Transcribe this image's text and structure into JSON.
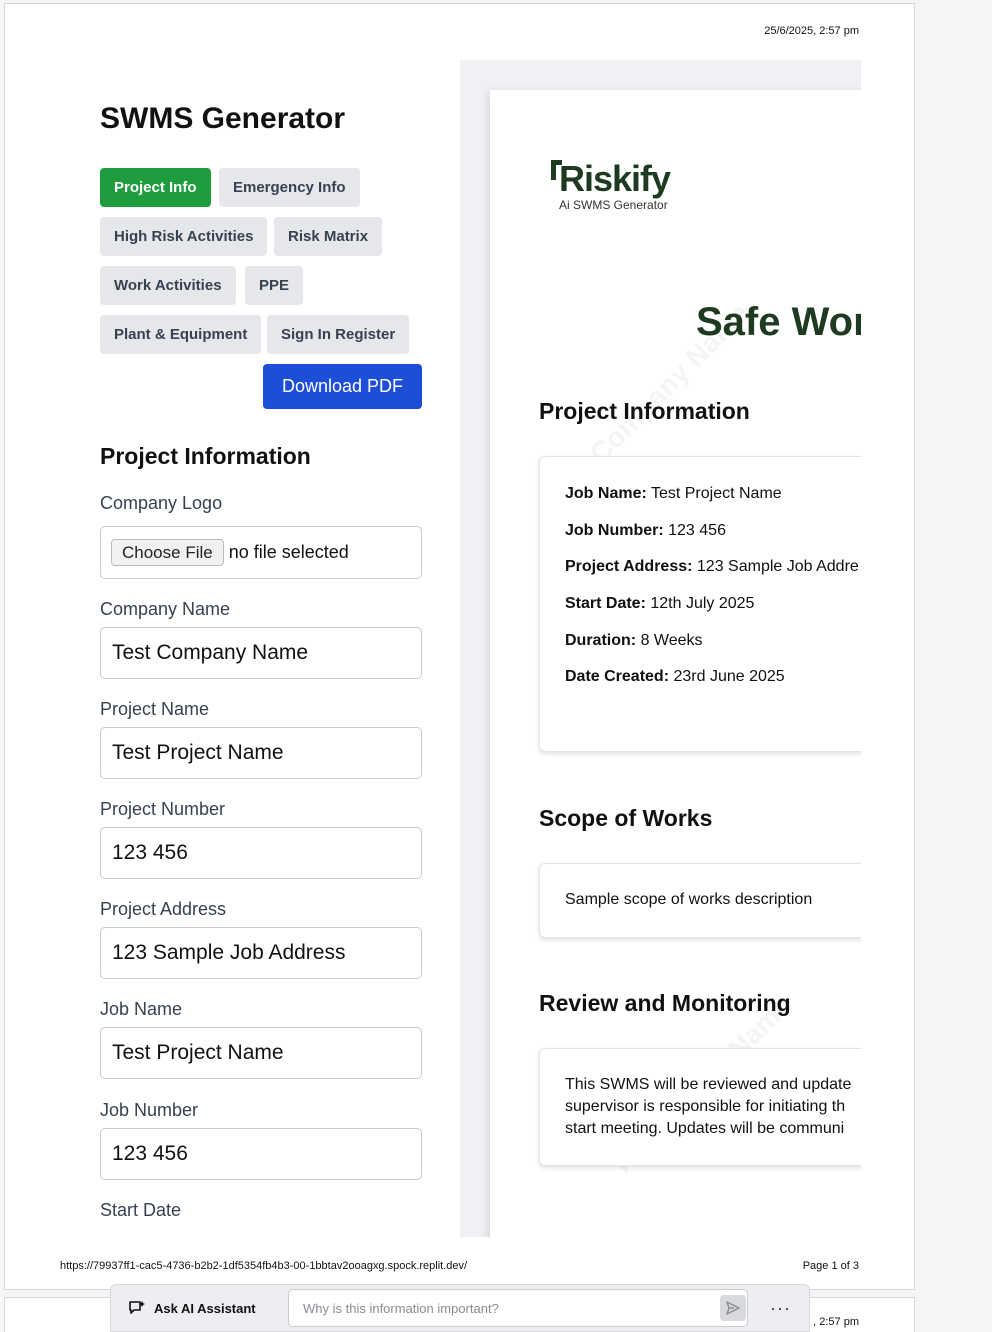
{
  "print": {
    "datetime": "25/6/2025, 2:57 pm",
    "url": "https://79937ff1-cac5-4736-b2b2-1df5354fb4b3-00-1bbtav2ooagxg.spock.replit.dev/",
    "page_label": "Page 1 of 3",
    "next_page_time": ", 2:57 pm"
  },
  "app": {
    "title": "SWMS Generator",
    "tabs": [
      {
        "label": "Project Info",
        "active": true
      },
      {
        "label": "Emergency Info"
      },
      {
        "label": "High Risk Activities"
      },
      {
        "label": "Risk Matrix"
      },
      {
        "label": "Work Activities"
      },
      {
        "label": "PPE"
      },
      {
        "label": "Plant & Equipment"
      },
      {
        "label": "Sign In Register"
      }
    ],
    "download_label": "Download PDF",
    "accent_color": "#1f9d3e",
    "download_color": "#1d4ed8"
  },
  "form": {
    "section_title": "Project Information",
    "logo_label": "Company Logo",
    "file_button": "Choose File",
    "file_status": "no file selected",
    "fields": [
      {
        "label": "Company Name",
        "value": "Test Company Name"
      },
      {
        "label": "Project Name",
        "value": "Test Project Name"
      },
      {
        "label": "Project Number",
        "value": "123 456"
      },
      {
        "label": "Project Address",
        "value": "123 Sample Job Address"
      },
      {
        "label": "Job Name",
        "value": "Test Project Name"
      },
      {
        "label": "Job Number",
        "value": "123 456"
      }
    ],
    "next_label": "Start Date"
  },
  "preview": {
    "logo_text": "Riskify",
    "logo_subtitle": "Ai SWMS Generator",
    "doc_title": "Safe Wor",
    "project_info": {
      "heading": "Project Information",
      "rows": [
        {
          "key": "Job Name:",
          "value": "Test Project Name"
        },
        {
          "key": "Job Number:",
          "value": "123 456"
        },
        {
          "key": "Project Address:",
          "value": "123 Sample Job Addre"
        },
        {
          "key": "Start Date:",
          "value": "12th July 2025"
        },
        {
          "key": "Duration:",
          "value": "8 Weeks"
        },
        {
          "key": "Date Created:",
          "value": "23rd June 2025"
        }
      ]
    },
    "scope": {
      "heading": "Scope of Works",
      "text": "Sample scope of works description"
    },
    "review": {
      "heading": "Review and Monitoring",
      "lines": [
        "This SWMS will be reviewed and update",
        "supervisor is responsible for initiating th",
        "start meeting. Updates will be communi"
      ]
    }
  },
  "assistant": {
    "label": "Ask AI Assistant",
    "placeholder": "Why is this information important?",
    "more": "···"
  }
}
